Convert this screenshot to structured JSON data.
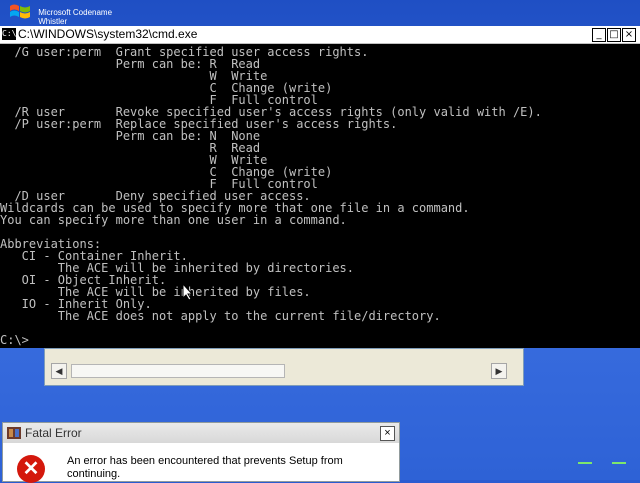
{
  "branding": {
    "line1": "Microsoft Codename",
    "line2": "Whistler"
  },
  "cmd_window": {
    "title": "C:\\WINDOWS\\system32\\cmd.exe",
    "icon_text": "C:\\",
    "minimize_symbol": "_",
    "maximize_symbol": "□",
    "close_symbol": "×",
    "lines": [
      "  /G user:perm  Grant specified user access rights.",
      "                Perm can be: R  Read",
      "                             W  Write",
      "                             C  Change (write)",
      "                             F  Full control",
      "  /R user       Revoke specified user's access rights (only valid with /E).",
      "  /P user:perm  Replace specified user's access rights.",
      "                Perm can be: N  None",
      "                             R  Read",
      "                             W  Write",
      "                             C  Change (write)",
      "                             F  Full control",
      "  /D user       Deny specified user access.",
      "Wildcards can be used to specify more that one file in a command.",
      "You can specify more than one user in a command.",
      "",
      "Abbreviations:",
      "   CI - Container Inherit.",
      "        The ACE will be inherited by directories.",
      "   OI - Object Inherit.",
      "        The ACE will be inherited by files.",
      "   IO - Inherit Only.",
      "        The ACE does not apply to the current file/directory.",
      "",
      "C:\\>"
    ]
  },
  "background_window": {
    "scroll_left": "◀",
    "scroll_right": "▶"
  },
  "error_dialog": {
    "title": "Fatal Error",
    "close_symbol": "×",
    "icon_symbol": "✕",
    "message": "An error has been encountered that prevents Setup from continuing."
  },
  "colors": {
    "console_bg": "#000000",
    "console_fg": "#c0c0c0",
    "desktop": "#2a5bd1",
    "error_icon": "#d4180c",
    "progress": "#7ee66c"
  }
}
